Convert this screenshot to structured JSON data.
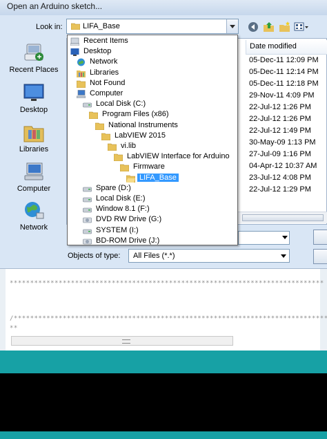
{
  "window": {
    "title": "Open an Arduino sketch..."
  },
  "lookin": {
    "label": "Look in:",
    "value": "LIFA_Base"
  },
  "places": [
    {
      "label": "Recent Places",
      "icon": "recent-places-icon"
    },
    {
      "label": "Desktop",
      "icon": "desktop-icon"
    },
    {
      "label": "Libraries",
      "icon": "libraries-icon"
    },
    {
      "label": "Computer",
      "icon": "computer-icon"
    },
    {
      "label": "Network",
      "icon": "network-icon"
    }
  ],
  "list": {
    "date_header": "Date modified",
    "dates": [
      "05-Dec-11 12:09 PM",
      "05-Dec-11 12:14 PM",
      "05-Dec-11 12:18 PM",
      "29-Nov-11 4:09 PM",
      "22-Jul-12 1:26 PM",
      "22-Jul-12 1:26 PM",
      "22-Jul-12 1:49 PM",
      "30-May-09 1:13 PM",
      "27-Jul-09 1:16 PM",
      "04-Apr-12 10:37 AM",
      "23-Jul-12 4:08 PM",
      "22-Jul-12 1:29 PM"
    ]
  },
  "dropdown": {
    "items": [
      {
        "label": "Recent Items",
        "icon": "recent-items-icon",
        "indent": 0
      },
      {
        "label": "Desktop",
        "icon": "desktop-icon",
        "indent": 0
      },
      {
        "label": "Network",
        "icon": "network-icon",
        "indent": 1
      },
      {
        "label": "Libraries",
        "icon": "libraries-icon",
        "indent": 1
      },
      {
        "label": "Not Found",
        "icon": "folder-icon",
        "indent": 1
      },
      {
        "label": "Computer",
        "icon": "computer-icon",
        "indent": 1
      },
      {
        "label": "Local Disk (C:)",
        "icon": "drive-icon",
        "indent": 2
      },
      {
        "label": "Program Files (x86)",
        "icon": "folder-icon",
        "indent": 3
      },
      {
        "label": "National Instruments",
        "icon": "folder-icon",
        "indent": 4
      },
      {
        "label": "LabVIEW 2015",
        "icon": "folder-icon",
        "indent": 5
      },
      {
        "label": "vi.lib",
        "icon": "folder-icon",
        "indent": 6
      },
      {
        "label": "LabVIEW Interface for Arduino",
        "icon": "folder-icon",
        "indent": 7
      },
      {
        "label": "Firmware",
        "icon": "folder-icon",
        "indent": 8
      },
      {
        "label": "LIFA_Base",
        "icon": "folder-open-icon",
        "indent": 9,
        "selected": true
      },
      {
        "label": "Spare (D:)",
        "icon": "drive-icon",
        "indent": 2
      },
      {
        "label": "Local Disk (E:)",
        "icon": "drive-icon",
        "indent": 2
      },
      {
        "label": "Window 8.1 (F:)",
        "icon": "drive-icon",
        "indent": 2
      },
      {
        "label": "DVD RW Drive (G:)",
        "icon": "dvd-drive-icon",
        "indent": 2
      },
      {
        "label": "SYSTEM (I:)",
        "icon": "drive-icon",
        "indent": 2
      },
      {
        "label": "BD-ROM Drive (J:)",
        "icon": "dvd-drive-icon",
        "indent": 2
      }
    ]
  },
  "types": {
    "label": "Objects of type:",
    "value": "All Files (*.*)"
  },
  "editor": {
    "line1": "*****************************************************************************",
    "line2": "/*****************************************************************************",
    "line3": " **"
  },
  "colors": {
    "accent": "#17a1a5",
    "selection": "#3399ff",
    "dialog_bg": "#d9e6f5"
  }
}
